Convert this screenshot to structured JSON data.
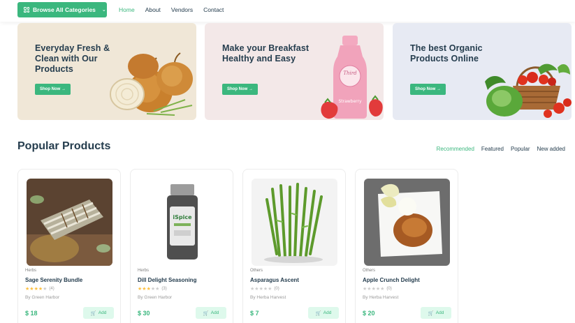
{
  "nav": {
    "browse_label": "Browse All Categories",
    "links": [
      "Home",
      "About",
      "Vendors",
      "Contact"
    ]
  },
  "banners": [
    {
      "title_lines": [
        "Everyday Fresh &",
        "Clean with Our",
        "Products"
      ],
      "button": "Shop Now →"
    },
    {
      "title_lines": [
        "Make your Breakfast",
        "Healthy and Easy"
      ],
      "button": "Shop Now →",
      "bottle_text": "Third",
      "bottle_text2": "Strawberry"
    },
    {
      "title_lines": [
        "The best Organic",
        "Products Online"
      ],
      "button": "Shop Now →"
    }
  ],
  "section": {
    "title": "Popular Products",
    "tabs": [
      "Recommended",
      "Featured",
      "Popular",
      "New added"
    ]
  },
  "products": [
    {
      "category": "Herbs",
      "name": "Sage Serenity Bundle",
      "stars": 4,
      "count": "(4)",
      "by": "By Green Harbor",
      "price": "$ 18",
      "add": "Add"
    },
    {
      "category": "Herbs",
      "name": "Dill Delight Seasoning",
      "stars": 3,
      "count": "(3)",
      "by": "By Green Harbor",
      "price": "$ 30",
      "add": "Add",
      "jar_label": "iSpice"
    },
    {
      "category": "Others",
      "name": "Asparagus Ascent",
      "stars": 0,
      "count": "(0)",
      "by": "By Herba Harvest",
      "price": "$ 7",
      "add": "Add"
    },
    {
      "category": "Others",
      "name": "Apple Crunch Delight",
      "stars": 0,
      "count": "(0)",
      "by": "By Herba Harvest",
      "price": "$ 20",
      "add": "Add"
    }
  ],
  "colors": {
    "accent": "#3bb77e",
    "accent_light": "#def9ec",
    "heading": "#253d4e",
    "star": "#fdc040"
  }
}
